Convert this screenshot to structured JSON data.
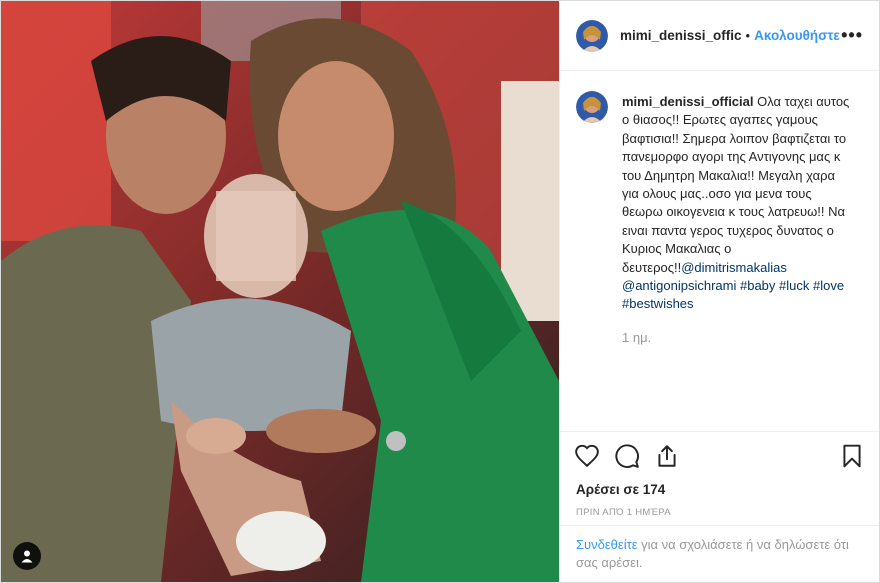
{
  "header": {
    "username": "mimi_denissi_offic",
    "separator": "•",
    "follow_label": "Ακολουθήστε",
    "more_label": "•••"
  },
  "caption": {
    "username": "mimi_denissi_official",
    "text": "Ολα ταχει αυτος ο θιασος!! Ερωτες αγαπες γαμους βαφτισια!! Σημερα λοιπον βαφτιζεται το πανεμορφο αγορι της Αντιγονης μας κ του Δημητρη Μακαλια!! Μεγαλη χαρα για ολους μας..οσο για μενα τους θεωρω οικογενεια κ τους λατρευω!! Να ειναι παντα γερος τυχερος δυνατος ο Κυριος Μακαλιας ο δευτερος!!",
    "mention1": "@dimitrismakalias",
    "mention2": "@antigonipsichrami",
    "tag_baby": "#baby",
    "tag_luck": "#luck",
    "tag_love": "#love",
    "tag_bestwishes": "#bestwishes",
    "time_ago": "1 ημ."
  },
  "actions": {
    "like_icon": "heart-icon",
    "comment_icon": "comment-icon",
    "share_icon": "share-icon",
    "save_icon": "bookmark-icon"
  },
  "likes_text": "Αρέσει σε 174",
  "date_text": "ΠΡΙΝ ΑΠΌ 1 ΗΜΈΡΑ",
  "login_prompt": {
    "link": "Συνδεθείτε",
    "rest": " για να σχολιάσετε ή να δηλώσετε ότι σας αρέσει."
  },
  "colors": {
    "accent": "#3897f0",
    "hashtag": "#003569",
    "muted": "#999999"
  }
}
